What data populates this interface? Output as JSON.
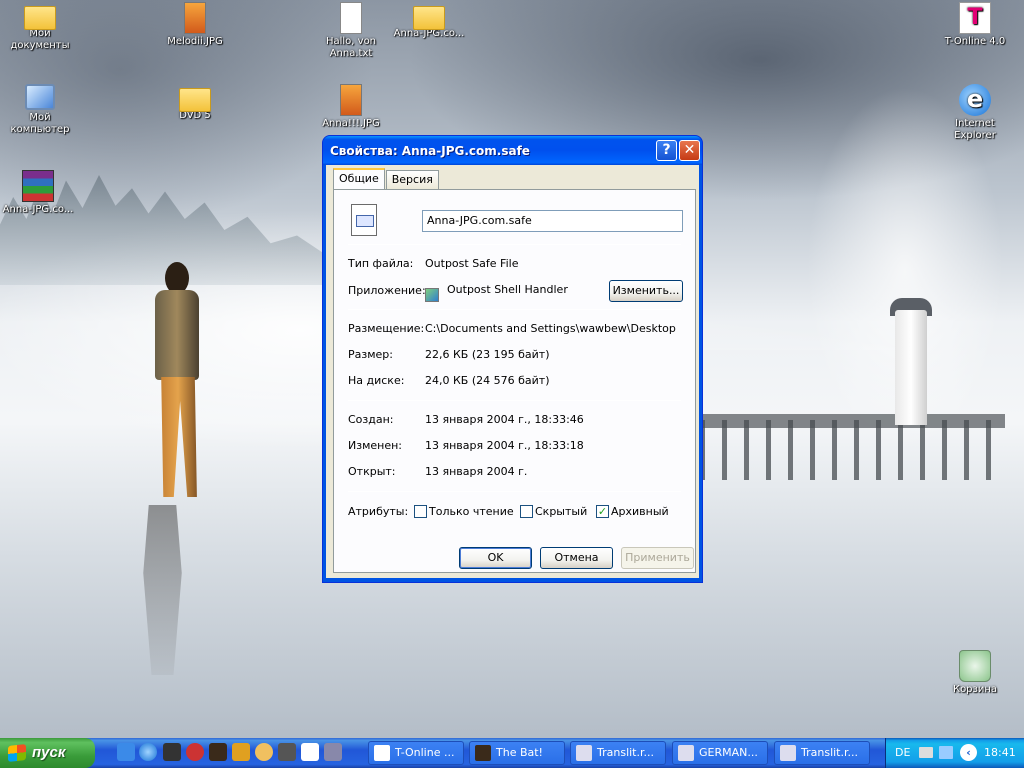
{
  "desktop": {
    "icons": [
      {
        "label": "Мои документы"
      },
      {
        "label": "Мой компьютер"
      },
      {
        "label": "Anna-JPG.co..."
      },
      {
        "label": "Melodii.JPG"
      },
      {
        "label": "DVD 5"
      },
      {
        "label": "Hallo, von Anna.txt"
      },
      {
        "label": "Anna!!!.JPG"
      },
      {
        "label": "Anna-JPG.co..."
      },
      {
        "label": "T-Online 4.0"
      },
      {
        "label": "Internet Explorer"
      },
      {
        "label": "Корзина"
      }
    ],
    "tonline_badge": "T",
    "ie_glyph": "e"
  },
  "dialog": {
    "title": "Свойства: Anna-JPG.com.safe",
    "help_glyph": "?",
    "close_glyph": "✕",
    "tabs": [
      {
        "label": "Общие"
      },
      {
        "label": "Версия"
      }
    ],
    "filename": "Anna-JPG.com.safe",
    "type_label": "Тип файла:",
    "type_value": "Outpost Safe File",
    "app_label": "Приложение:",
    "app_value": "Outpost Shell Handler",
    "change_button": "Изменить...",
    "location_label": "Размещение:",
    "location_value": "C:\\Documents and Settings\\wawbew\\Desktop",
    "size_label": "Размер:",
    "size_value": "22,6 КБ (23 195 байт)",
    "ondisk_label": "На диске:",
    "ondisk_value": "24,0 КБ (24 576 байт)",
    "created_label": "Создан:",
    "created_value": "13 января 2004 г., 18:33:46",
    "modified_label": "Изменен:",
    "modified_value": "13 января 2004 г., 18:33:18",
    "opened_label": "Открыт:",
    "opened_value": "13 января 2004 г.",
    "attributes_label": "Атрибуты:",
    "attr_readonly": "Только чтение",
    "attr_hidden": "Скрытый",
    "attr_archive": "Архивный",
    "attr_readonly_checked": false,
    "attr_hidden_checked": false,
    "attr_archive_checked": true,
    "check_mark": "✓",
    "ok": "OK",
    "cancel": "Отмена",
    "apply": "Применить"
  },
  "taskbar": {
    "start": "пуск",
    "tasks": [
      {
        "label": "T-Online ..."
      },
      {
        "label": "The Bat!"
      },
      {
        "label": "Translit.r..."
      },
      {
        "label": "GERMAN..."
      },
      {
        "label": "Translit.r..."
      }
    ],
    "lang": "DE",
    "time": "18:41",
    "colors": {
      "start_green": "#3c9a3c",
      "bar_blue": "#2157d7",
      "tray_blue": "#139ee9"
    }
  }
}
